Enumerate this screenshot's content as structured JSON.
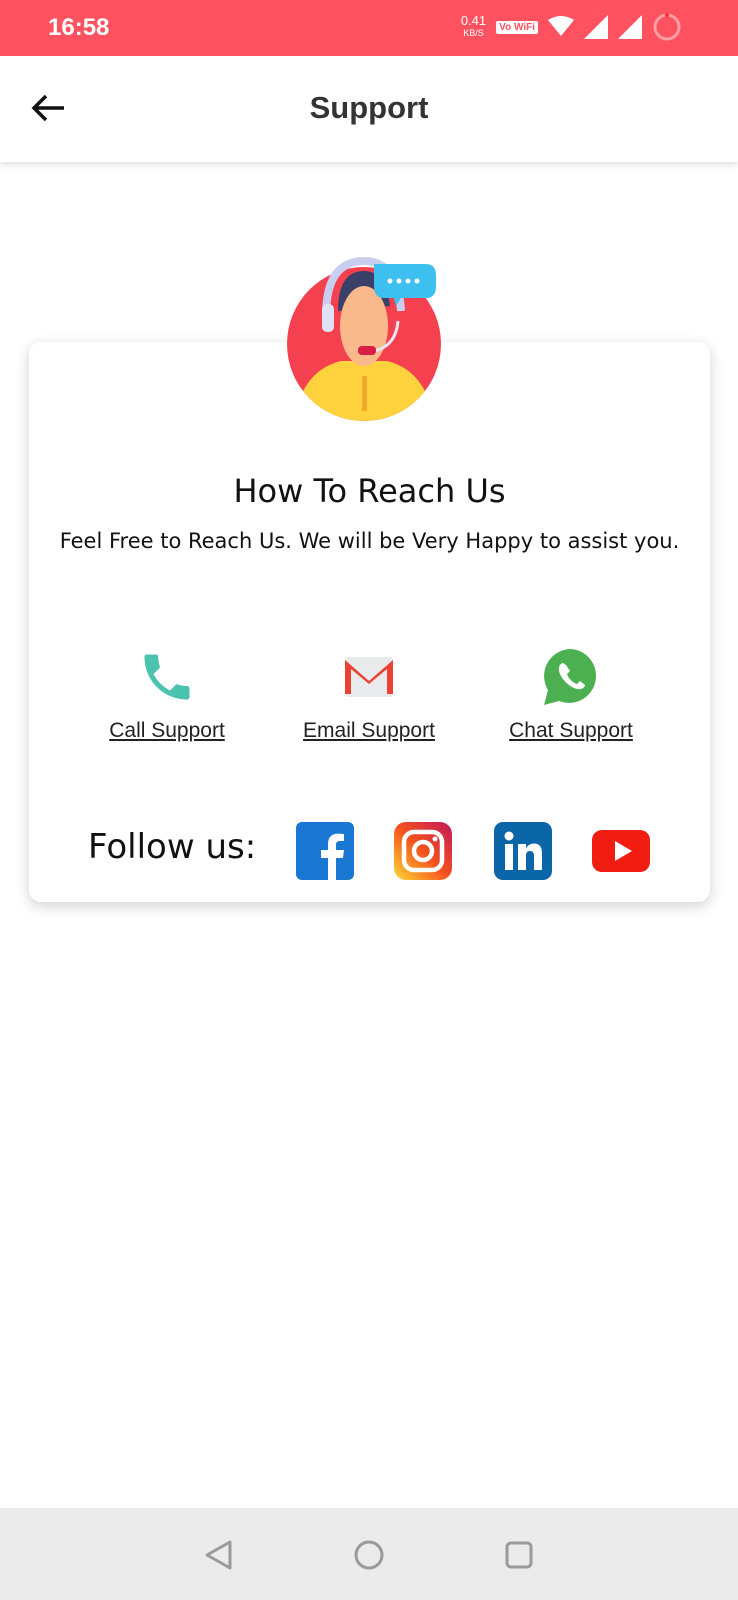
{
  "status_bar": {
    "time": "16:58",
    "speed": "0.41",
    "speed_unit": "KB/S",
    "vowifi": "Vo WiFi",
    "bg_color": "#fe5261"
  },
  "app_bar": {
    "title": "Support",
    "back_icon": "arrow-left-icon"
  },
  "card": {
    "title": "How To Reach Us",
    "subtitle": "Feel Free to Reach Us. We will be Very Happy to assist you.",
    "contacts": [
      {
        "label": "Call Support",
        "icon": "phone-icon"
      },
      {
        "label": "Email Support",
        "icon": "gmail-icon"
      },
      {
        "label": "Chat Support",
        "icon": "whatsapp-icon"
      }
    ],
    "follow_label": "Follow us:",
    "socials": [
      "facebook-icon",
      "instagram-icon",
      "linkedin-icon",
      "youtube-icon"
    ]
  },
  "nav_bar": [
    "back",
    "home",
    "recents"
  ]
}
